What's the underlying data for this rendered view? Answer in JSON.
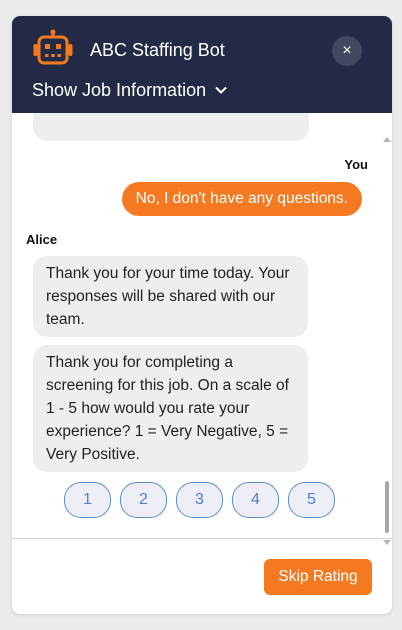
{
  "header": {
    "title": "ABC Staffing Bot",
    "icon": "robot-icon",
    "close_label": "×",
    "job_toggle_label": "Show Job Information"
  },
  "conversation": {
    "messages": [
      {
        "sender": "You",
        "text": "No, I don't have any questions."
      },
      {
        "sender": "Alice",
        "text": "Thank you for your time today. Your responses will be shared with our team."
      },
      {
        "sender": "Alice",
        "text": "Thank you for completing a screening for this job. On a scale of 1 - 5 how would you rate your experience? 1 = Very Negative, 5 = Very Positive."
      }
    ],
    "rating_options": [
      "1",
      "2",
      "3",
      "4",
      "5"
    ]
  },
  "footer": {
    "skip_label": "Skip Rating"
  },
  "colors": {
    "header_bg": "#232a45",
    "accent": "#f47920",
    "rating_border": "#5b8ed6",
    "bubble_bg": "#eeeef0"
  }
}
